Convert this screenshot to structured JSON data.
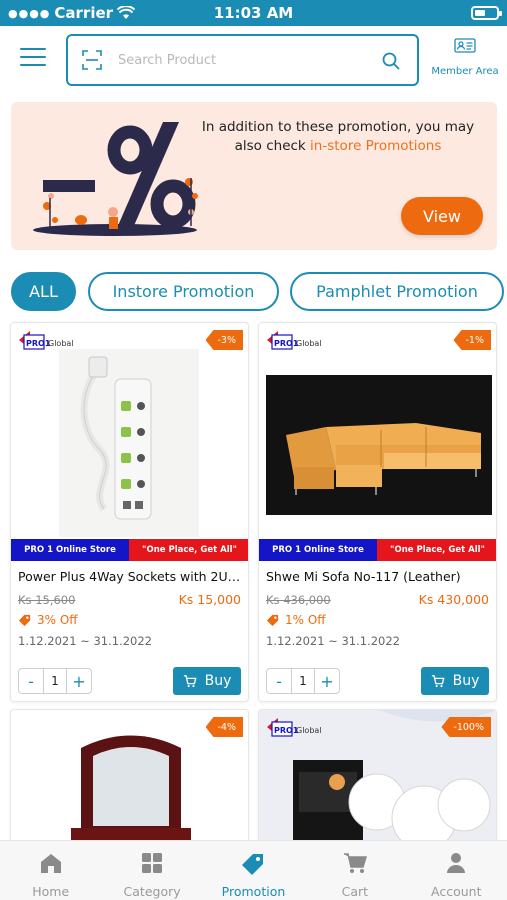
{
  "status_bar": {
    "carrier": "Carrier",
    "time": "11:03 AM"
  },
  "header": {
    "search_placeholder": "Search Product",
    "member_area_label": "Member Area"
  },
  "banner": {
    "text_main": "In addition to these promotion, you may also check ",
    "text_highlight": "in-store Promotions",
    "view_label": "View",
    "highlight_color": "#f0701f"
  },
  "filters": [
    {
      "label": "ALL",
      "active": true
    },
    {
      "label": "Instore Promotion",
      "active": false
    },
    {
      "label": "Pamphlet Promotion",
      "active": false
    }
  ],
  "brand_text": "PRO 1 Global",
  "products": [
    {
      "discount": "-3%",
      "store_left": "PRO 1 Online Store",
      "store_right": "\"One Place, Get All\"",
      "name": "Power Plus 4Way Sockets with 2USB...",
      "old_price": "Ks 15,600",
      "new_price": "Ks 15,000",
      "off": "3% Off",
      "dates": "1.12.2021 ~ 31.1.2022",
      "qty": "1",
      "buy_label": "Buy"
    },
    {
      "discount": "-1%",
      "store_left": "PRO 1 Online Store",
      "store_right": "\"One Place, Get All\"",
      "name": "Shwe Mi Sofa No-117 (Leather)",
      "old_price": "Ks 436,000",
      "new_price": "Ks 430,000",
      "off": "1% Off",
      "dates": "1.12.2021 ~ 31.1.2022",
      "qty": "1",
      "buy_label": "Buy"
    },
    {
      "discount": "-4%"
    },
    {
      "discount": "-100%"
    }
  ],
  "stepper": {
    "minus": "-",
    "plus": "+"
  },
  "bottom_nav": [
    {
      "label": "Home",
      "icon": "home-icon",
      "active": false
    },
    {
      "label": "Category",
      "icon": "category-icon",
      "active": false
    },
    {
      "label": "Promotion",
      "icon": "tag-icon",
      "active": true
    },
    {
      "label": "Cart",
      "icon": "cart-icon",
      "active": false
    },
    {
      "label": "Account",
      "icon": "account-icon",
      "active": false
    }
  ],
  "colors": {
    "primary": "#1b8cb4",
    "accent": "#ee6a0f",
    "banner_bg": "#fde9df"
  }
}
